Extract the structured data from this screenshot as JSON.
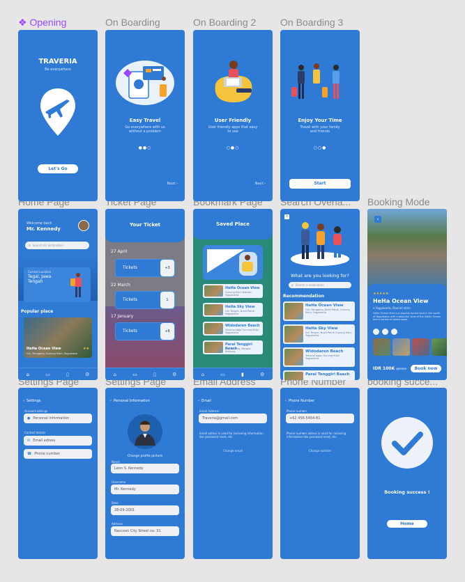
{
  "frame_labels": {
    "opening": "Opening",
    "onb1": "On Boarding",
    "onb2": "On Boarding 2",
    "onb3": "On Boarding 3",
    "home": "Home Page",
    "ticket": "Ticket Page",
    "bookmark": "Bookmark Page",
    "search": "Search Overla...",
    "booking": "Booking Mode",
    "settings1": "Settings Page",
    "settings2": "Settings Page",
    "email": "Email Address",
    "phone": "Phone Number",
    "success": "booking succe..."
  },
  "opening": {
    "brand": "TRAVERIA",
    "tagline": "Be everywhere",
    "button": "Let's Go"
  },
  "onb1": {
    "title": "Easy Travel",
    "desc": "Go everywhere with us without a problem",
    "next": "Next"
  },
  "onb2": {
    "title": "User Friendly",
    "desc": "User friendly apps that easy to use",
    "next": "Next"
  },
  "onb3": {
    "title": "Enjoy Your Time",
    "desc": "Travel with your family and friends",
    "button": "Start"
  },
  "home": {
    "welcome": "Welcome back",
    "user": "Mr. Kennedy",
    "search_placeholder": "Search for destination",
    "location_label": "Current Location",
    "location": "Tegal, Jawa Tengah",
    "popular": "Popular place",
    "place_name": "HeHa Ocean View",
    "place_desc": "Giri, Panggang, Gunung Kidul, Yogyakarta"
  },
  "ticket": {
    "title": "Your Ticket",
    "groups": [
      {
        "date": "27 April",
        "label": "Tickets",
        "count": "+3"
      },
      {
        "date": "22 March",
        "label": "Tickets",
        "count": "1"
      },
      {
        "date": "17 January",
        "label": "Tickets",
        "count": "+8"
      }
    ]
  },
  "bookmark": {
    "title": "Saved Place",
    "items": [
      {
        "name": "HeHa Ocean View",
        "desc": "Gunung Kidul Daerah, Yogyakarta"
      },
      {
        "name": "HeHa Sky View",
        "desc": "Giri Tengah, Bukit Patuk Yogyakarta"
      },
      {
        "name": "Widodaren Beach",
        "desc": "Tanjung Jogja Gunung Kidul Yogyakarta"
      },
      {
        "name": "Parai Tenggiri Beach",
        "desc": "Sei. Tanjung, Bangka Belitung"
      }
    ]
  },
  "search": {
    "question": "What are you looking for?",
    "placeholder": "Search a destination",
    "recommendation": "Recommendation",
    "items": [
      {
        "name": "HeHa Ocean View",
        "desc": "Giri, Panggang, Bukit Patuk, Gunung Kidul, Yogyakarta"
      },
      {
        "name": "HeHa Sky View",
        "desc": "Giri Tengah, Bukit Patuk Gunung Kidul Yogyakarta"
      },
      {
        "name": "Widodaren Beach",
        "desc": "Tanjung Jogja, Gunung Kidul Yogyakarta"
      },
      {
        "name": "Parai Tenggiri Beach",
        "desc": ""
      }
    ]
  },
  "booking": {
    "stars": "★★★★★",
    "name": "HeHa Ocean View",
    "location": "Yogyakarta, Daerah Istim",
    "desc": "HeHa Ocean View is a popular tourist spot in the south of Yogyakarta with a beautiful view of the Indian Ocean and a variety of photo spots.",
    "price": "IDR 100K",
    "per": "/person",
    "button": "Book now"
  },
  "settings1": {
    "title": "Settings",
    "account_label": "Account settings",
    "personal": "Personal information",
    "contact_label": "Contact details",
    "email": "Email adress",
    "phone": "Phone number"
  },
  "settings2": {
    "title": "Personal Information",
    "change_pic": "Change profile picture",
    "name_label": "Name",
    "name": "Leon S. Kennedy",
    "username_label": "Username",
    "username": "Mr. Kennedy",
    "date_label": "Date",
    "date": "28-09-2001",
    "address_label": "Address",
    "address": "Raccoon City Street no. 31"
  },
  "email": {
    "title": "Email",
    "label": "Email Address",
    "value": "Traveria@gmail.com",
    "note": "Email adress is used for recieving information like password reset, etc.",
    "change": "Change email"
  },
  "phone": {
    "title": "Phone Number",
    "label": "Phone number",
    "value": "+62 456-5464-81",
    "note": "Phone number adress is used for recieving information like password reset, etc.",
    "change": "Change number"
  },
  "success": {
    "message": "Booking success !",
    "button": "Home"
  }
}
